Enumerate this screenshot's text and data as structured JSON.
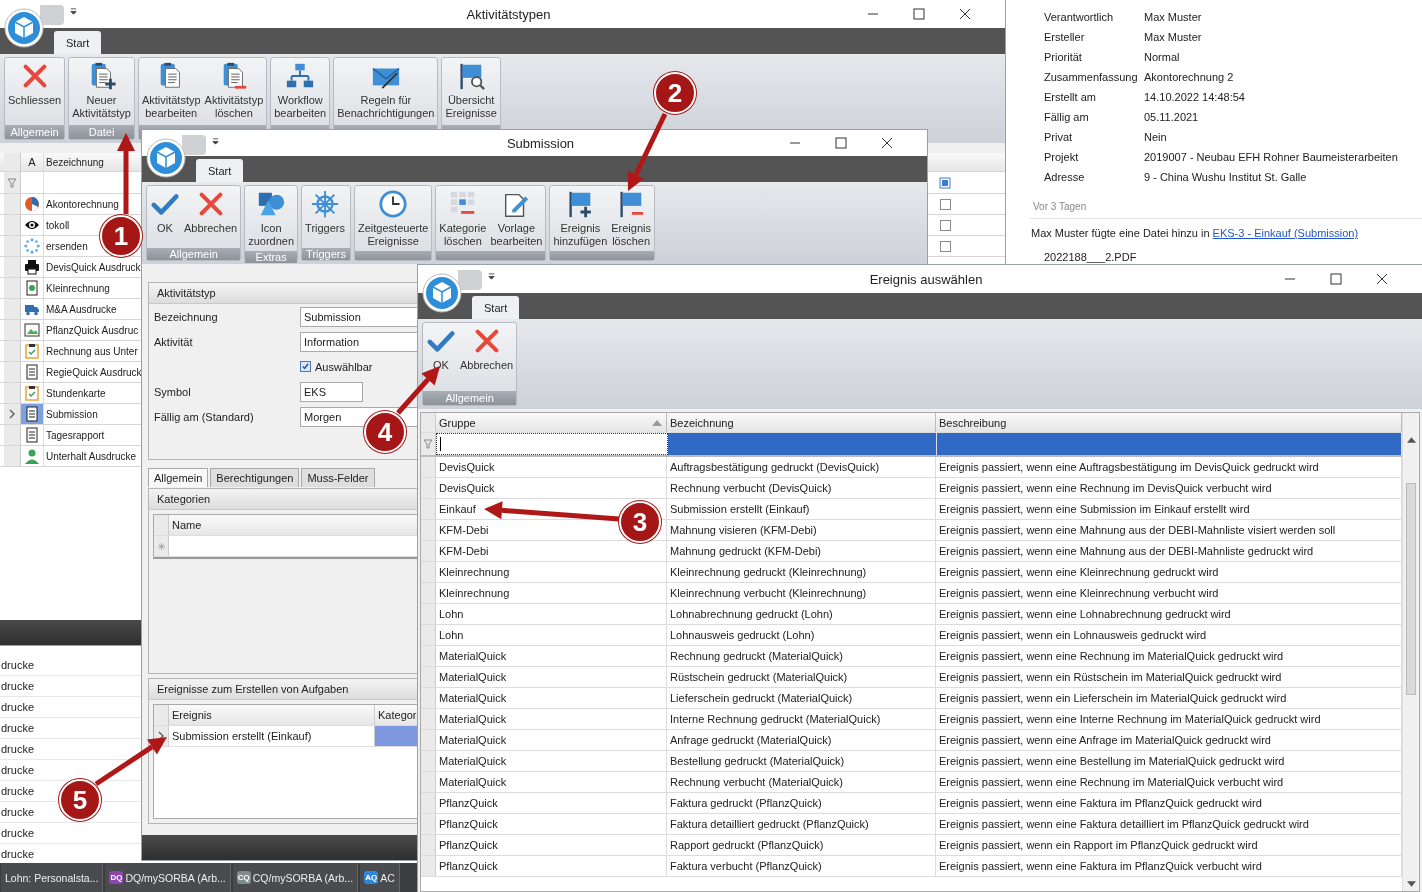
{
  "detail_panel": {
    "fields": [
      {
        "label": "Verantwortlich",
        "value": "Max Muster"
      },
      {
        "label": "Ersteller",
        "value": "Max Muster"
      },
      {
        "label": "Priorität",
        "value": "Normal"
      },
      {
        "label": "Zusammenfassung",
        "value": "Akontorechnung 2"
      },
      {
        "label": "Erstellt am",
        "value": "14.10.2022 14:48:54"
      },
      {
        "label": "Fällig am",
        "value": "05.11.2021"
      },
      {
        "label": "Privat",
        "value": "Nein"
      },
      {
        "label": "Projekt",
        "value": "2019007 - Neubau EFH Rohner Baumeisterarbeiten"
      },
      {
        "label": "Adresse",
        "value": "9 - China Wushu Institut St. Galle"
      }
    ],
    "timestamp": "Vor 3 Tagen",
    "activity": {
      "text": "Max Muster fügte eine Datei hinzu in ",
      "link": "EKS-3 - Einkauf (Submission)"
    },
    "file": "2022188___2.PDF"
  },
  "background_list": [
    "drucke",
    "drucke",
    "drucke",
    "drucke",
    "drucke",
    "drucke",
    "drucke",
    "drucke",
    "drucke",
    "drucke"
  ],
  "taskbar": [
    {
      "label": "Lohn: Personalsta..."
    },
    {
      "badge": "DQ",
      "color": "#8e44ad",
      "label": "DQ/mySORBA (Arb..."
    },
    {
      "badge": "CQ",
      "color": "#7f8c8d",
      "label": "CQ/mySORBA (Arb..."
    },
    {
      "badge": "AQ",
      "color": "#2e86de",
      "label": "AC"
    }
  ],
  "window_activity_types": {
    "title": "Aktivitätstypen",
    "tabs": [
      {
        "label": "Start",
        "selected": true
      }
    ],
    "ribbon_groups": [
      {
        "label": "Allgemein",
        "buttons": [
          "Schliessen"
        ]
      },
      {
        "label": "Datei",
        "buttons": [
          "Neuer Aktivitätstyp"
        ]
      },
      {
        "buttons": [
          "Aktivitätstyp bearbeiten",
          "Aktivitätstyp löschen"
        ]
      },
      {
        "buttons": [
          "Workflow bearbeiten"
        ]
      },
      {
        "buttons": [
          "Regeln für Benachrichtigungen"
        ]
      },
      {
        "buttons": [
          "Übersicht Ereignisse"
        ]
      }
    ],
    "grid": {
      "columns": [
        "A",
        "Bezeichnung"
      ],
      "rows": [
        {
          "name": "Akontorechnung",
          "selected": false,
          "checked": false
        },
        {
          "name": "tokoll",
          "selected": false,
          "checked": false
        },
        {
          "name": "ersenden",
          "selected": false,
          "checked": false
        },
        {
          "name": "DevisQuick Ausdruck",
          "selected": false
        },
        {
          "name": "Kleinrechnung",
          "selected": false
        },
        {
          "name": "M&A Ausdrucke",
          "selected": false
        },
        {
          "name": "PflanzQuick Ausdruc",
          "selected": false
        },
        {
          "name": "Rechnung aus Unter",
          "selected": false
        },
        {
          "name": "RegieQuick Ausdruck",
          "selected": false
        },
        {
          "name": "Stundenkarte",
          "selected": false
        },
        {
          "name": "Submission",
          "selected": true
        },
        {
          "name": "Tagesrapport",
          "selected": false
        },
        {
          "name": "Unterhalt Ausdrucke",
          "selected": false
        }
      ]
    }
  },
  "window_submission": {
    "title": "Submission",
    "tabs": [
      {
        "label": "Start",
        "selected": true
      }
    ],
    "ribbon_groups": [
      {
        "label": "Allgemein",
        "buttons": [
          "OK",
          "Abbrechen"
        ]
      },
      {
        "label": "Extras",
        "buttons": [
          "Icon zuordnen"
        ]
      },
      {
        "label": "Triggers",
        "buttons": [
          "Triggers"
        ]
      },
      {
        "buttons": [
          "Zeitgesteuerte Ereignisse"
        ]
      },
      {
        "buttons": [
          "Kategorie löschen",
          "Vorlage bearbeiten"
        ]
      },
      {
        "buttons": [
          "Ereignis hinzufügen",
          "Ereignis löschen"
        ]
      }
    ],
    "form": {
      "title": "Aktivitätstyp",
      "fields": [
        {
          "kind": "text",
          "label": "Bezeichnung",
          "value": "Submission"
        },
        {
          "kind": "text",
          "label": "Aktivität",
          "value": "Information"
        },
        {
          "kind": "checkbox",
          "label": "Auswählbar",
          "checked": true
        },
        {
          "kind": "short",
          "label": "Symbol",
          "value": "EKS"
        },
        {
          "kind": "text",
          "label": "Fällig am (Standard)",
          "value": "Morgen"
        }
      ]
    },
    "tabs_lower": [
      {
        "label": "Allgemein",
        "selected": true
      },
      {
        "label": "Berechtigungen",
        "selected": false
      },
      {
        "label": "Muss-Felder",
        "selected": false
      }
    ],
    "categories": {
      "title": "Kategorien",
      "columns": [
        "Name"
      ]
    },
    "events": {
      "title": "Ereignisse zum Erstellen von Aufgaben",
      "columns": [
        "Ereignis",
        "Kategor"
      ],
      "rows": [
        {
          "ereignis": "Submission erstellt (Einkauf)",
          "selected": true
        }
      ]
    }
  },
  "window_select_event": {
    "title": "Ereignis auswählen",
    "tabs": [
      {
        "label": "Start",
        "selected": true
      }
    ],
    "ribbon_groups": [
      {
        "label": "Allgemein",
        "buttons": [
          "OK",
          "Abbrechen"
        ]
      }
    ],
    "columns": [
      {
        "label": "Gruppe",
        "sorted": true
      },
      {
        "label": "Bezeichnung",
        "sorted": false
      },
      {
        "label": "Beschreibung",
        "sorted": false
      }
    ],
    "rows": [
      [
        "DevisQuick",
        "Auftragsbestätigung gedruckt (DevisQuick)",
        "Ereignis passiert, wenn eine Auftragsbestätigung im DevisQuick gedruckt wird"
      ],
      [
        "DevisQuick",
        "Rechnung verbucht (DevisQuick)",
        "Ereignis passiert, wenn eine Rechnung im DevisQuick verbucht wird"
      ],
      [
        "Einkauf",
        "Submission erstellt (Einkauf)",
        "Ereignis passiert, wenn eine Submission im Einkauf erstellt wird"
      ],
      [
        "KFM-Debi",
        "Mahnung visieren (KFM-Debi)",
        "Ereignis passiert, wenn eine Mahnung aus der DEBI-Mahnliste visiert werden soll"
      ],
      [
        "KFM-Debi",
        "Mahnung gedruckt (KFM-Debi)",
        "Ereignis passiert, wenn eine Mahnung aus der DEBI-Mahnliste gedruckt wird"
      ],
      [
        "Kleinrechnung",
        "Kleinrechnung gedruckt (Kleinrechnung)",
        "Ereignis passiert, wenn eine Kleinrechnung gedruckt wird"
      ],
      [
        "Kleinrechnung",
        "Kleinrechnung verbucht (Kleinrechnung)",
        "Ereignis passiert, wenn eine Kleinrechnung verbucht wird"
      ],
      [
        "Lohn",
        "Lohnabrechnung gedruckt (Lohn)",
        "Ereignis passiert, wenn eine Lohnabrechnung gedruckt wird"
      ],
      [
        "Lohn",
        "Lohnausweis gedruckt (Lohn)",
        "Ereignis passiert, wenn ein Lohnausweis gedruckt wird"
      ],
      [
        "MaterialQuick",
        "Rechnung gedruckt (MaterialQuick)",
        "Ereignis passiert, wenn eine Rechnung im MaterialQuick gedruckt wird"
      ],
      [
        "MaterialQuick",
        "Rüstschein gedruckt (MaterialQuick)",
        "Ereignis passiert, wenn ein Rüstschein im MaterialQuick gedruckt wird"
      ],
      [
        "MaterialQuick",
        "Lieferschein gedruckt (MaterialQuick)",
        "Ereignis passiert, wenn ein Lieferschein im MaterialQuick gedruckt wird"
      ],
      [
        "MaterialQuick",
        "Interne Rechnung gedruckt (MaterialQuick)",
        "Ereignis passiert, wenn eine Interne Rechnung im MaterialQuick gedruckt wird"
      ],
      [
        "MaterialQuick",
        "Anfrage gedruckt (MaterialQuick)",
        "Ereignis passiert, wenn eine Anfrage im MaterialQuick gedruckt wird"
      ],
      [
        "MaterialQuick",
        "Bestellung gedruckt (MaterialQuick)",
        "Ereignis passiert, wenn eine Bestellung im MaterialQuick gedruckt wird"
      ],
      [
        "MaterialQuick",
        "Rechnung verbucht (MaterialQuick)",
        "Ereignis passiert, wenn eine Rechnung im MaterialQuick verbucht wird"
      ],
      [
        "PflanzQuick",
        "Faktura gedruckt (PflanzQuick)",
        "Ereignis passiert, wenn eine Faktura im PflanzQuick gedruckt wird"
      ],
      [
        "PflanzQuick",
        "Faktura detailliert gedruckt (PflanzQuick)",
        "Ereignis passiert, wenn eine Faktura detailliert im PflanzQuick gedruckt wird"
      ],
      [
        "PflanzQuick",
        "Rapport gedruckt (PflanzQuick)",
        "Ereignis passiert, wenn ein Rapport im PflanzQuick gedruckt wird"
      ],
      [
        "PflanzQuick",
        "Faktura verbucht (PflanzQuick)",
        "Ereignis passiert, wenn eine Faktura im PflanzQuick verbucht wird"
      ]
    ]
  },
  "annotations": [
    {
      "label": "1"
    },
    {
      "label": "2"
    },
    {
      "label": "3"
    },
    {
      "label": "4"
    },
    {
      "label": "5"
    }
  ]
}
